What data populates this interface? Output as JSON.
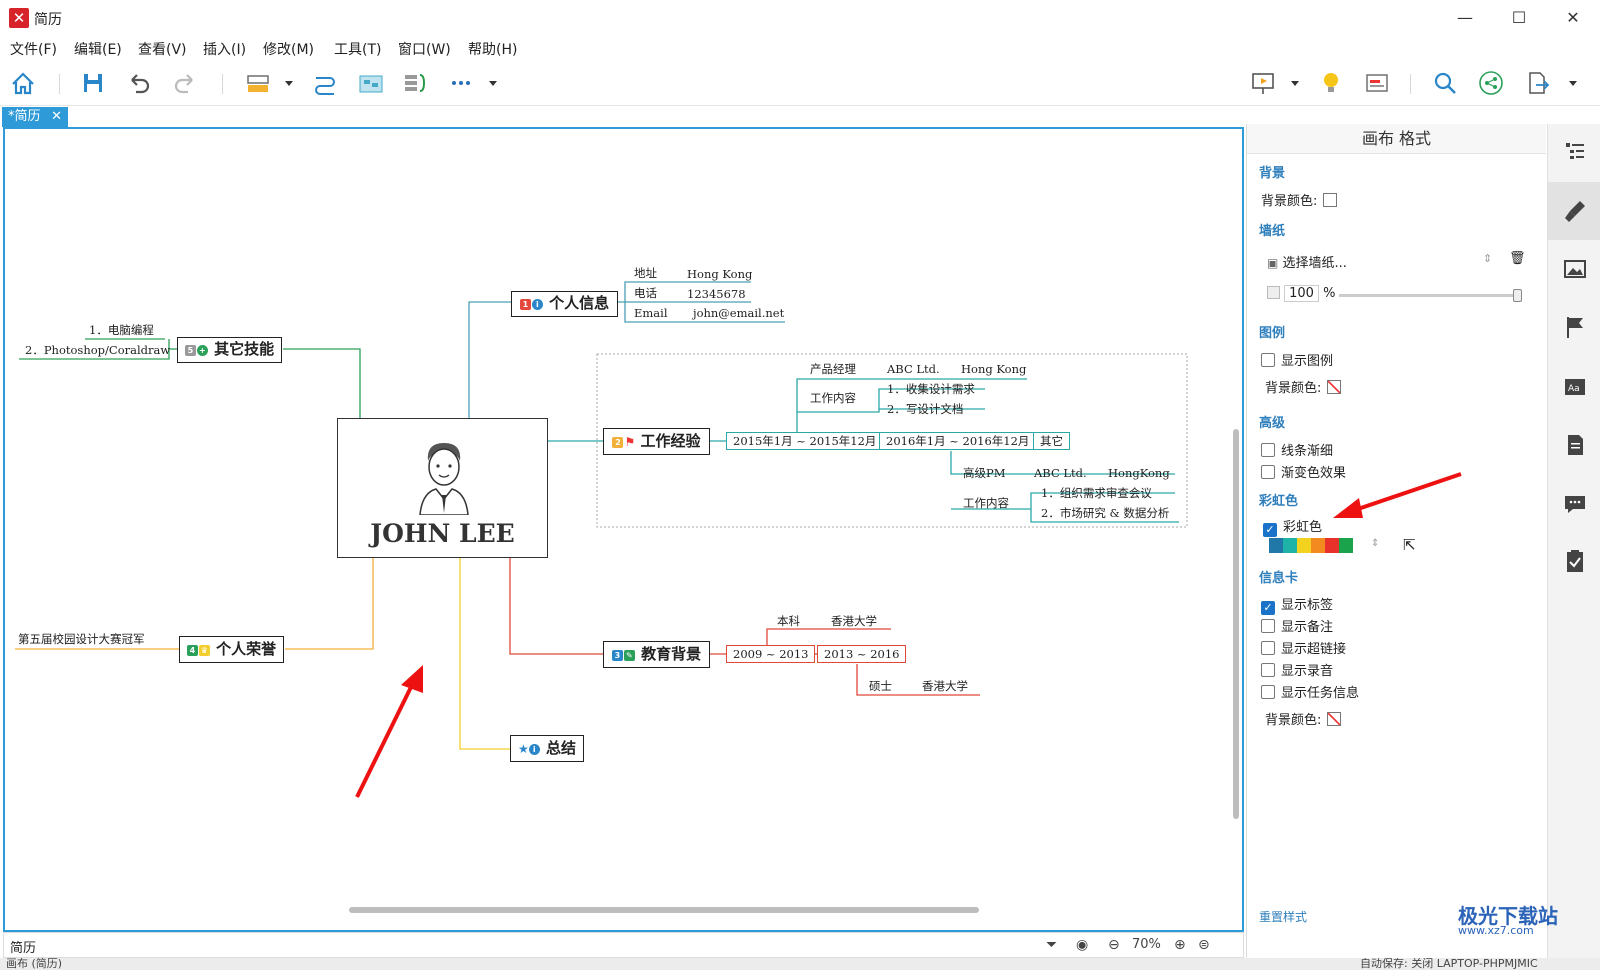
{
  "window": {
    "title": "简历"
  },
  "menu": [
    "文件(F)",
    "编辑(E)",
    "查看(V)",
    "插入(I)",
    "修改(M)",
    "工具(T)",
    "窗口(W)",
    "帮助(H)"
  ],
  "tab": {
    "label": "*简历"
  },
  "mindmap": {
    "root": "JOHN LEE",
    "personal_info": {
      "label": "个人信息",
      "badge": "1",
      "rows": [
        {
          "k": "地址",
          "v": "Hong Kong"
        },
        {
          "k": "电话",
          "v": "12345678"
        },
        {
          "k": "Email",
          "v": "john@email.net"
        }
      ]
    },
    "skills": {
      "label": "其它技能",
      "badge": "5",
      "items": [
        "1．电脑编程",
        "2．Photoshop/Coraldraw"
      ]
    },
    "work": {
      "label": "工作经验",
      "badge": "2",
      "period1": "2015年1月 ~ 2015年12月",
      "period2": "2016年1月 ~ 2016年12月",
      "other": "其它",
      "job1": {
        "title": "产品经理",
        "company": "ABC Ltd.",
        "place": "Hong Kong",
        "content_label": "工作内容",
        "tasks": [
          "1．收集设计需求",
          "2．写设计文档"
        ]
      },
      "job2": {
        "title": "高级PM",
        "company": "ABC Ltd.",
        "place": "HongKong",
        "content_label": "工作内容",
        "tasks": [
          "1．组织需求审查会议",
          "2．市场研究 & 数据分析"
        ]
      }
    },
    "honors": {
      "label": "个人荣誉",
      "badge": "4",
      "item": "第五届校园设计大赛冠军"
    },
    "education": {
      "label": "教育背景",
      "badge": "3",
      "p1": "2009 ~ 2013",
      "p2": "2013 ~ 2016",
      "deg1": "本科",
      "school1": "香港大学",
      "deg2": "硕士",
      "school2": "香港大学"
    },
    "summary": {
      "label": "总结"
    }
  },
  "footer": {
    "sheet": "简历",
    "zoom": "70%"
  },
  "status": {
    "left": "画布 (简历)",
    "right": "自动保存: 关闭    LAPTOP-PHPMJMIC"
  },
  "panel": {
    "title": "画布 格式",
    "bg_section": "背景",
    "bg_color": "背景颜色:",
    "wallpaper_section": "墙纸",
    "wallpaper_select": "选择墙纸...",
    "opacity": "100",
    "opacity_unit": "%",
    "legend_section": "图例",
    "show_legend": "显示图例",
    "legend_bg": "背景颜色:",
    "advanced_section": "高级",
    "taper": "线条渐细",
    "gradient": "渐变色效果",
    "rainbow_section": "彩虹色",
    "rainbow_label": "彩虹色",
    "rainbow_colors": [
      "#1f78a8",
      "#1fb3a8",
      "#f2d21f",
      "#f28a1f",
      "#e8312a",
      "#1aa34a"
    ],
    "infocard_section": "信息卡",
    "show_labels": "显示标签",
    "show_notes": "显示备注",
    "show_links": "显示超链接",
    "show_audio": "显示录音",
    "show_tasks": "显示任务信息",
    "card_bg": "背景颜色:",
    "reset": "重置样式"
  },
  "watermark": {
    "main": "极光下载站",
    "sub": "www.xz7.com"
  }
}
